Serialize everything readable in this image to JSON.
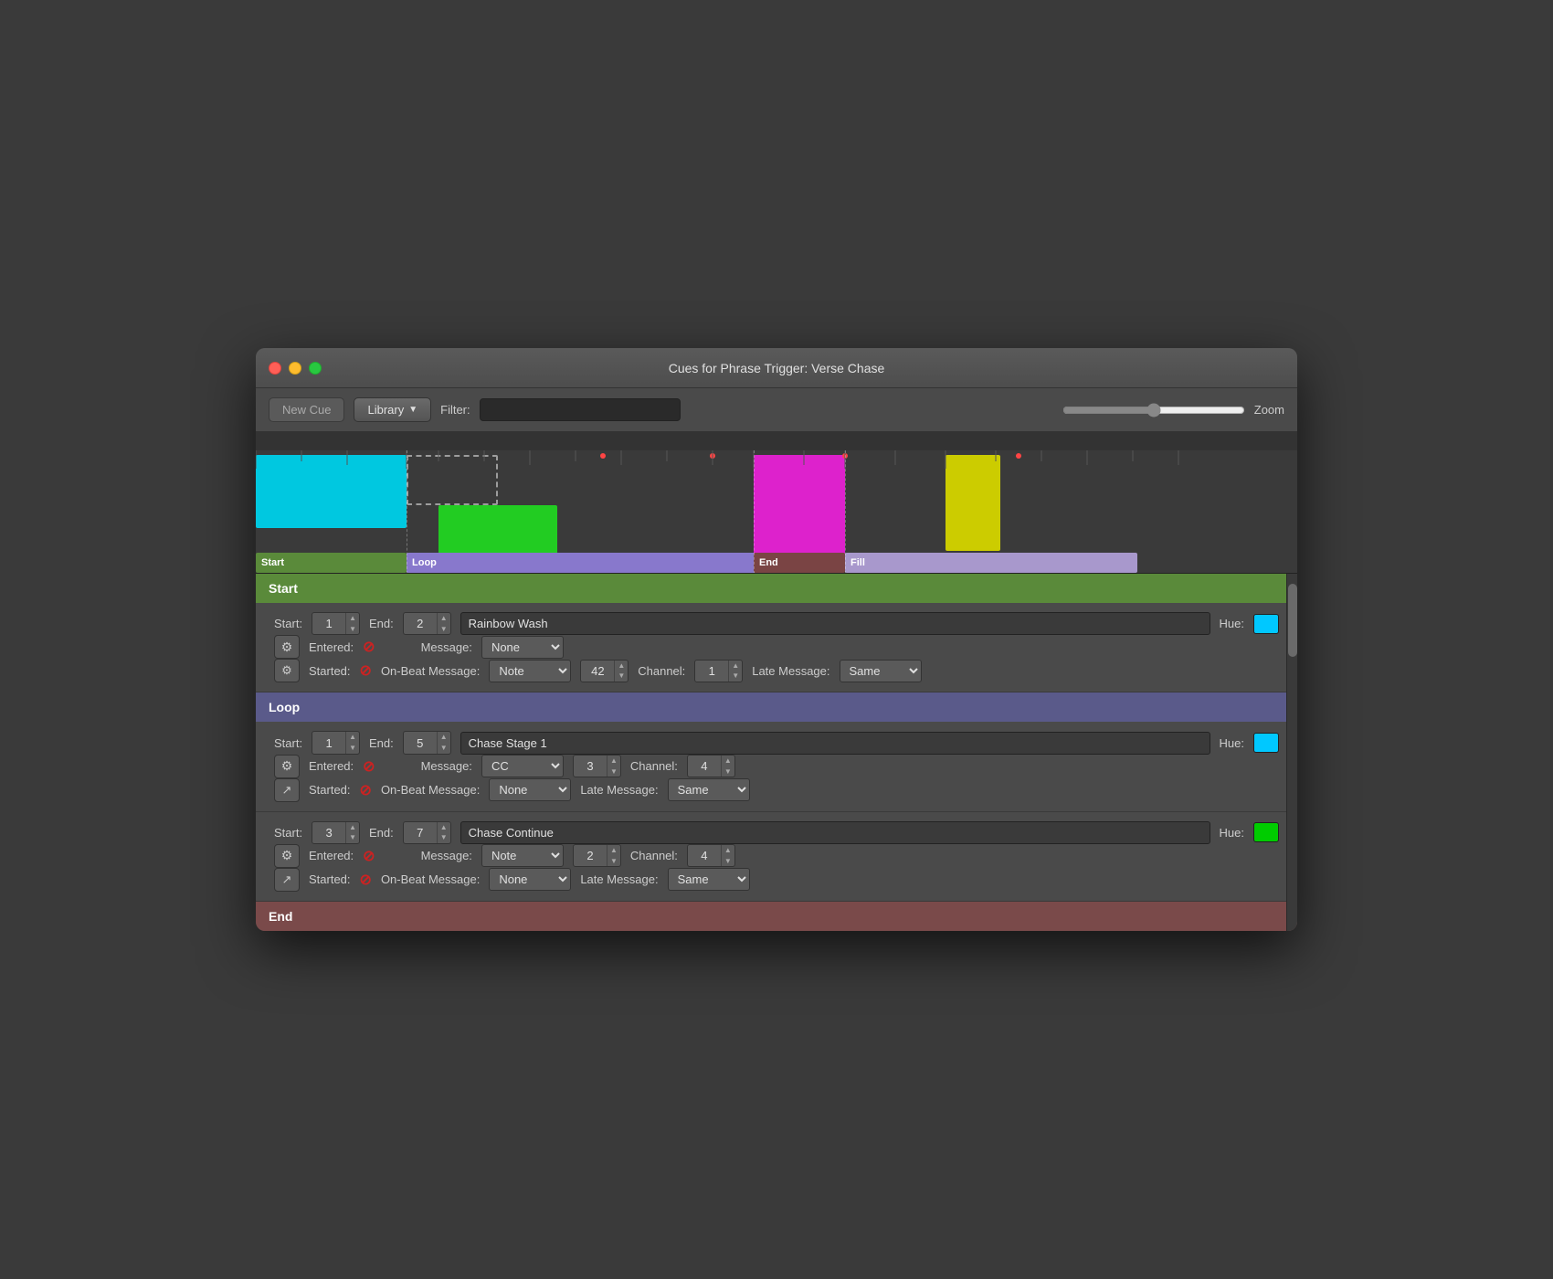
{
  "window": {
    "title": "Cues for Phrase Trigger: Verse Chase"
  },
  "toolbar": {
    "new_cue_label": "New Cue",
    "library_label": "Library",
    "filter_label": "Filter:",
    "filter_placeholder": "",
    "zoom_label": "Zoom"
  },
  "timeline": {
    "sections": [
      "Start",
      "Loop",
      "End",
      "Fill"
    ]
  },
  "sections": [
    {
      "id": "start",
      "label": "Start",
      "color_class": "section-start",
      "cues": [
        {
          "start": "1",
          "end": "2",
          "name": "Rainbow Wash",
          "hue_color": "#00c8ff",
          "entered_blocked": true,
          "message_type": "None",
          "started_blocked": true,
          "on_beat_message": "Note",
          "on_beat_value": "42",
          "on_beat_channel": "1",
          "late_message": "Same",
          "icon1": "⚙",
          "icon2": "⚙"
        }
      ]
    },
    {
      "id": "loop",
      "label": "Loop",
      "color_class": "section-loop",
      "cues": [
        {
          "start": "1",
          "end": "5",
          "name": "Chase Stage 1",
          "hue_color": "#00c8ff",
          "entered_blocked": true,
          "message_type": "CC",
          "message_value": "3",
          "message_channel": "4",
          "started_blocked": true,
          "on_beat_message": "None",
          "late_message": "Same",
          "icon1": "⚙",
          "icon2": "↗"
        },
        {
          "start": "3",
          "end": "7",
          "name": "Chase Continue",
          "hue_color": "#00cc00",
          "entered_blocked": true,
          "message_type": "Note",
          "message_value": "2",
          "message_channel": "4",
          "started_blocked": true,
          "on_beat_message": "None",
          "late_message": "Same",
          "icon1": "⚙",
          "icon2": "↗"
        }
      ]
    },
    {
      "id": "end",
      "label": "End",
      "color_class": "section-end",
      "cues": []
    }
  ]
}
